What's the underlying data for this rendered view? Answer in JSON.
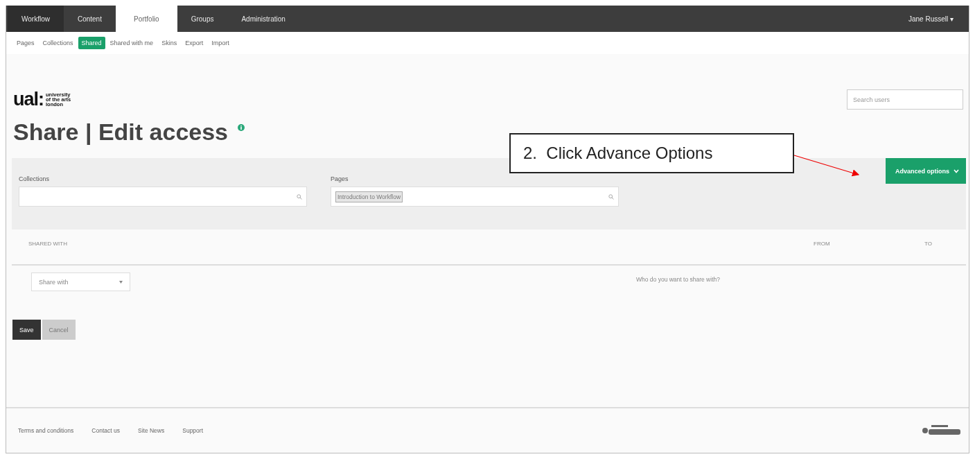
{
  "top_nav": [
    {
      "label": "Workflow",
      "selected": false
    },
    {
      "label": "Content",
      "selected": false
    },
    {
      "label": "Portfolio",
      "selected": true
    },
    {
      "label": "Groups",
      "selected": false
    },
    {
      "label": "Administration",
      "selected": false
    }
  ],
  "user_menu": {
    "label": "Jane Russell",
    "caret": "▾"
  },
  "sub_nav": [
    {
      "label": "Pages",
      "selected": false
    },
    {
      "label": "Collections",
      "selected": false
    },
    {
      "label": "Shared",
      "selected": true
    },
    {
      "label": "Shared with me",
      "selected": false
    },
    {
      "label": "Skins",
      "selected": false
    },
    {
      "label": "Export",
      "selected": false
    },
    {
      "label": "Import",
      "selected": false
    }
  ],
  "logo": {
    "mark": "ual:",
    "lines": [
      "university",
      "of the arts",
      "london"
    ]
  },
  "search_users": {
    "placeholder": "Search users"
  },
  "heading": "Share | Edit access",
  "callout": {
    "text": "2.  Click Advance Options"
  },
  "advanced_button": {
    "label": "Advanced options"
  },
  "filters": [
    {
      "label": "Collections"
    },
    {
      "label": "Pages",
      "tags": [
        "Introduction to Workflow"
      ]
    }
  ],
  "table": {
    "columns": [
      "SHARED WITH",
      "FROM",
      "TO"
    ],
    "share_select": "Share with",
    "hint": "Who do you want to share with?"
  },
  "buttons": [
    {
      "label": "Save",
      "kind": "primary"
    },
    {
      "label": "Cancel",
      "kind": "secondary"
    }
  ],
  "footer_links": [
    "Terms and conditions",
    "Contact us",
    "Site News",
    "Support"
  ]
}
